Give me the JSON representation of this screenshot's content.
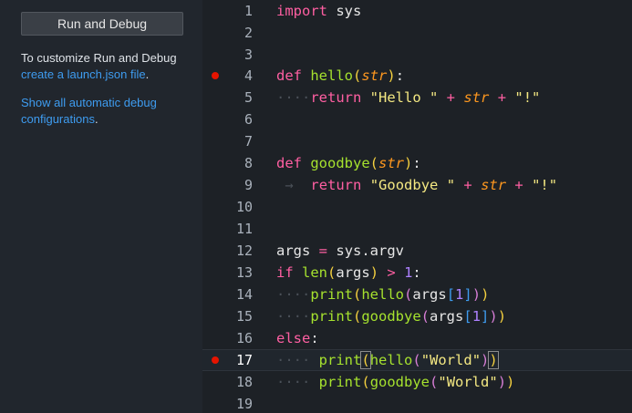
{
  "sidebar": {
    "run_button": "Run and Debug",
    "customize_text": "To customize Run and Debug",
    "create_link": "create a launch.json file",
    "create_suffix": ".",
    "show_link": "Show all automatic debug configurations",
    "show_suffix": "."
  },
  "editor": {
    "breakpoint_lines": [
      4,
      17
    ],
    "current_line": 17,
    "lines": [
      {
        "num": "1"
      },
      {
        "num": "2"
      },
      {
        "num": "3"
      },
      {
        "num": "4"
      },
      {
        "num": "5"
      },
      {
        "num": "6"
      },
      {
        "num": "7"
      },
      {
        "num": "8"
      },
      {
        "num": "9"
      },
      {
        "num": "10"
      },
      {
        "num": "11"
      },
      {
        "num": "12"
      },
      {
        "num": "13"
      },
      {
        "num": "14"
      },
      {
        "num": "15"
      },
      {
        "num": "16"
      },
      {
        "num": "17"
      },
      {
        "num": "18"
      },
      {
        "num": "19"
      }
    ],
    "tokens": {
      "import": "import",
      "sys": "sys",
      "def": "def",
      "hello": "hello",
      "str": "str",
      "return": "return",
      "hello_str": "\"Hello \"",
      "plus": "+",
      "bang": "\"!\"",
      "goodbye": "goodbye",
      "goodbye_str": "\"Goodbye \"",
      "args": "args",
      "eq": "=",
      "sys_argv": "sys.argv",
      "if": "if",
      "len": "len",
      "gt": ">",
      "one": "1",
      "print": "print",
      "else": "else",
      "world": "\"World\"",
      "dot4": "····",
      "dot8": "········",
      "arrow": "→"
    }
  },
  "colors": {
    "keyword": "#ff5fa2",
    "function": "#a6e22e",
    "param": "#fd971f",
    "string": "#f4e882",
    "number": "#ae81ff",
    "breakpoint": "#e51400",
    "link": "#3e9cf0"
  }
}
